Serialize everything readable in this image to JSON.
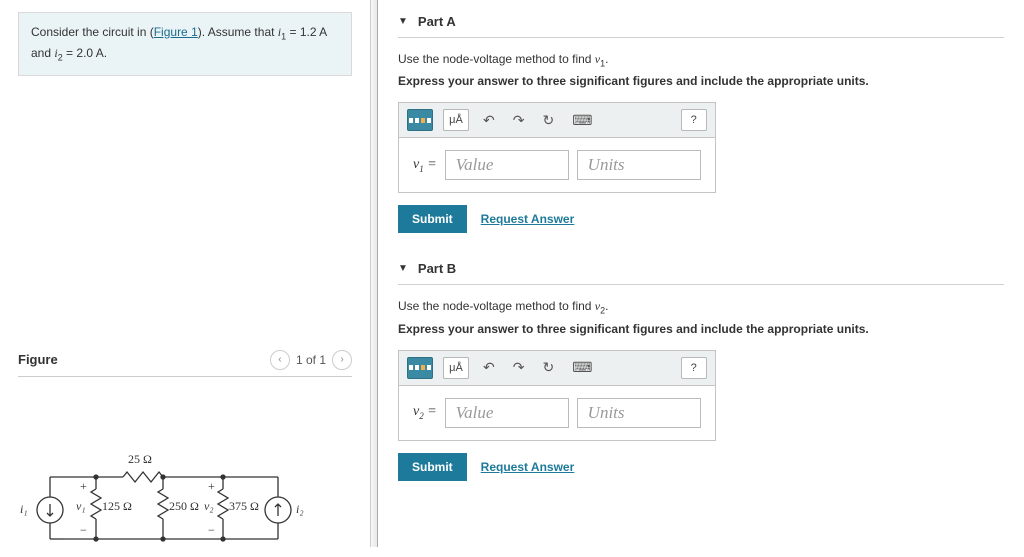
{
  "problem": {
    "prefix": "Consider the circuit in (",
    "figure_link": "Figure 1",
    "mid": "). Assume that ",
    "i1_var": "i",
    "i1_sub": "1",
    "eq1": " = 1.2 A",
    "and": "and ",
    "i2_var": "i",
    "i2_sub": "2",
    "eq2": " = 2.0 A."
  },
  "figure": {
    "heading": "Figure",
    "pager_text": "1 of 1",
    "labels": {
      "r_top": "25 Ω",
      "r1": "125 Ω",
      "r2": "250 Ω",
      "r3": "375 Ω",
      "v1": "v₁",
      "v2": "v₂",
      "i1": "i₁",
      "i2": "i₂",
      "plus": "+",
      "minus": "−"
    }
  },
  "partA": {
    "title": "Part A",
    "instr_pre": "Use the node-voltage method to find ",
    "instr_var": "v",
    "instr_sub": "1",
    "instr_post": ".",
    "bold": "Express your answer to three significant figures and include the appropriate units.",
    "var_label_pre": "v",
    "var_label_sub": "1",
    "var_label_eq": " =",
    "value_ph": "Value",
    "units_ph": "Units",
    "submit": "Submit",
    "request": "Request Answer",
    "toolbar": {
      "ua": "μÅ",
      "help": "?"
    }
  },
  "partB": {
    "title": "Part B",
    "instr_pre": "Use the node-voltage method to find ",
    "instr_var": "v",
    "instr_sub": "2",
    "instr_post": ".",
    "bold": "Express your answer to three significant figures and include the appropriate units.",
    "var_label_pre": "v",
    "var_label_sub": "2",
    "var_label_eq": " =",
    "value_ph": "Value",
    "units_ph": "Units",
    "submit": "Submit",
    "request": "Request Answer",
    "toolbar": {
      "ua": "μÅ",
      "help": "?"
    }
  }
}
